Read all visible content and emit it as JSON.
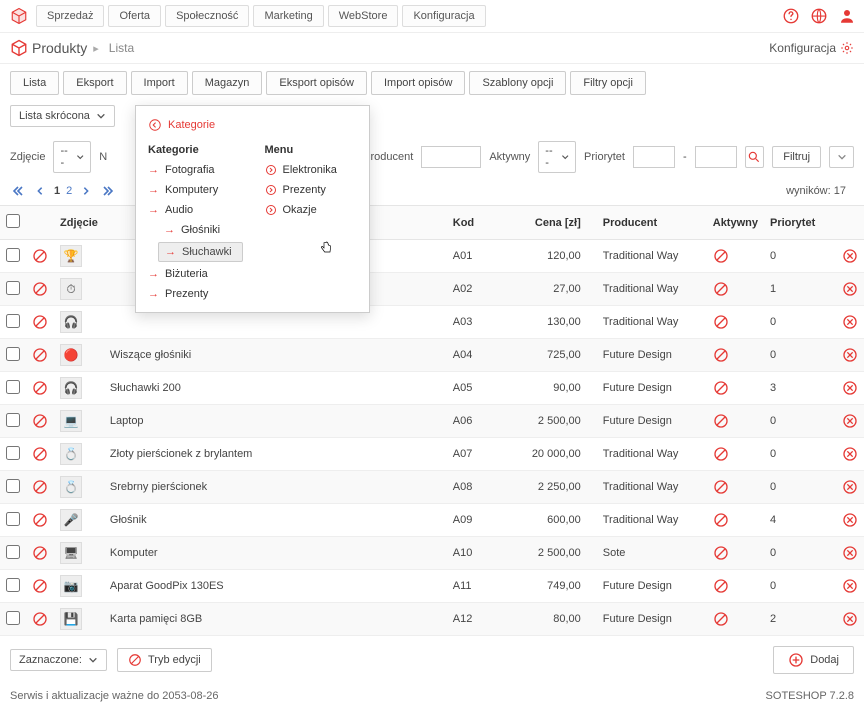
{
  "colors": {
    "accent": "#e53935"
  },
  "topnav": {
    "items": [
      "Sprzedaż",
      "Oferta",
      "Społeczność",
      "Marketing",
      "WebStore",
      "Konfiguracja"
    ]
  },
  "crumb": {
    "title": "Produkty",
    "sub": "Lista",
    "config": "Konfiguracja"
  },
  "tabs": [
    "Lista",
    "Eksport",
    "Import",
    "Magazyn",
    "Eksport opisów",
    "Import opisów",
    "Szablony opcji",
    "Filtry opcji"
  ],
  "toolbar": {
    "view_mode": "Lista skrócona"
  },
  "filters": {
    "zdjecie_label": "Zdjęcie",
    "zdjecie_value": "---",
    "name_label_prefix": "N",
    "producent_label": "Producent",
    "aktywny_label": "Aktywny",
    "aktywny_value": "---",
    "priorytet_label": "Priorytet",
    "sep": "-",
    "filter_btn": "Filtruj"
  },
  "pager": {
    "current": "1",
    "next": "2",
    "results_label": "wyników:",
    "results_count": "17"
  },
  "columns": {
    "zdjecie": "Zdjęcie",
    "kod": "Kod",
    "cena": "Cena [zł]",
    "producent": "Producent",
    "aktywny": "Aktywny",
    "priorytet": "Priorytet"
  },
  "rows": [
    {
      "name": "",
      "thumb": "🏆",
      "kod": "A01",
      "cena": "120,00",
      "prod": "Traditional Way",
      "pri": "0"
    },
    {
      "name": "",
      "thumb": "⏱",
      "kod": "A02",
      "cena": "27,00",
      "prod": "Traditional Way",
      "pri": "1"
    },
    {
      "name": "",
      "thumb": "🎧",
      "kod": "A03",
      "cena": "130,00",
      "prod": "Traditional Way",
      "pri": "0"
    },
    {
      "name": "Wiszące głośniki",
      "thumb": "🔴",
      "kod": "A04",
      "cena": "725,00",
      "prod": "Future Design",
      "pri": "0"
    },
    {
      "name": "Słuchawki 200",
      "thumb": "🎧",
      "kod": "A05",
      "cena": "90,00",
      "prod": "Future Design",
      "pri": "3"
    },
    {
      "name": "Laptop",
      "thumb": "💻",
      "kod": "A06",
      "cena": "2 500,00",
      "prod": "Future Design",
      "pri": "0"
    },
    {
      "name": "Złoty pierścionek z brylantem",
      "thumb": "💍",
      "kod": "A07",
      "cena": "20 000,00",
      "prod": "Traditional Way",
      "pri": "0"
    },
    {
      "name": "Srebrny pierścionek",
      "thumb": "💍",
      "kod": "A08",
      "cena": "2 250,00",
      "prod": "Traditional Way",
      "pri": "0"
    },
    {
      "name": "Głośnik",
      "thumb": "🎤",
      "kod": "A09",
      "cena": "600,00",
      "prod": "Traditional Way",
      "pri": "4"
    },
    {
      "name": "Komputer",
      "thumb": "🖥",
      "kod": "A10",
      "cena": "2 500,00",
      "prod": "Sote",
      "pri": "0"
    },
    {
      "name": "Aparat GoodPix 130ES",
      "thumb": "📷",
      "kod": "A11",
      "cena": "749,00",
      "prod": "Future Design",
      "pri": "0"
    },
    {
      "name": "Karta pamięci 8GB",
      "thumb": "💾",
      "kod": "A12",
      "cena": "80,00",
      "prod": "Future Design",
      "pri": "2"
    }
  ],
  "menu": {
    "title": "Kategorie",
    "left_head": "Kategorie",
    "right_head": "Menu",
    "left_items": [
      "Fotografia",
      "Komputery",
      "Audio"
    ],
    "audio_subs": [
      "Głośniki",
      "Słuchawki"
    ],
    "left_after": [
      "Biżuteria",
      "Prezenty"
    ],
    "right_items": [
      "Elektronika",
      "Prezenty",
      "Okazje"
    ]
  },
  "footer": {
    "zaznaczone": "Zaznaczone:",
    "tryb": "Tryb edycji",
    "dodaj": "Dodaj",
    "notice": "Serwis i aktualizacje ważne do 2053-08-26",
    "version": "SOTESHOP 7.2.8"
  }
}
